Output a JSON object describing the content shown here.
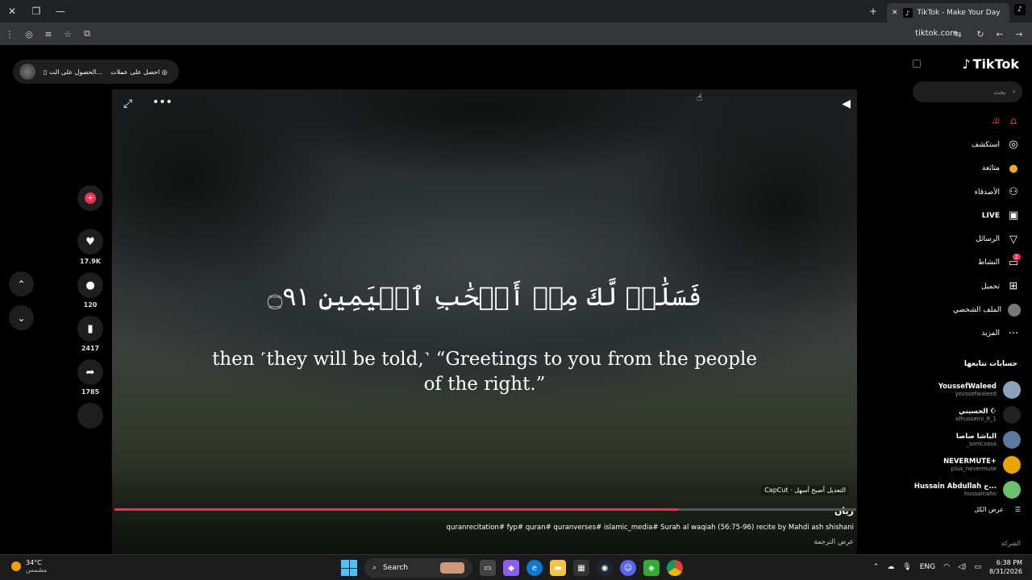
{
  "browser": {
    "tab_title": "TikTok - Make Your Day",
    "url": "tiktok.com",
    "new_tab_symbol": "+"
  },
  "promo": {
    "item1": "الحصول على الت...",
    "item2": "احصل على عملات"
  },
  "video": {
    "arabic_text": "فَسَلَٰمٞ لَّكَ مِنۡ أَصۡحَٰبِ ٱلۡيَمِينِ ۝٩١",
    "caption_line1": "then ˹they will be told,˺ “Greetings to you from the people",
    "caption_line2": "of the right.”",
    "capcut_label": "CapCut · التعديل أصبح أسهل",
    "author": "ريان",
    "description": "quranrecitation# fyp# quran# quranverses# islamic_media# Surah al waqiah (56:75-96) recite by Mahdi ash shishani",
    "translate": "عرض الترجمة",
    "progress_percent": 76
  },
  "actions": {
    "likes": "17.9K",
    "comments": "120",
    "saves": "2417",
    "shares": "1785"
  },
  "sidebar": {
    "logo": "TikTok",
    "search_placeholder": "بحث",
    "menu": [
      {
        "label": "لك",
        "icon": "home-icon"
      },
      {
        "label": "استكشف",
        "icon": "compass-icon"
      },
      {
        "label": "متابَعة",
        "icon": "following-icon"
      },
      {
        "label": "الأصدقاء",
        "icon": "friends-icon"
      },
      {
        "label": "LIVE",
        "icon": "live-icon"
      },
      {
        "label": "الرسائل",
        "icon": "messages-icon"
      },
      {
        "label": "النشاط",
        "icon": "activity-icon",
        "badge": "2"
      },
      {
        "label": "تحميل",
        "icon": "upload-icon"
      },
      {
        "label": "الملف الشخصي",
        "icon": "profile-icon"
      },
      {
        "label": "المزيد",
        "icon": "more-icon"
      }
    ],
    "following_title": "حسابات تتابعها",
    "accounts": [
      {
        "name": "YoussefWaleed",
        "handle": "yovssefwaleed"
      },
      {
        "name": "الحسيني ☪",
        "handle": "alhusseini_8_1"
      },
      {
        "name": "الباشا صاصا",
        "handle": "_sonicsasa"
      },
      {
        "name": "NEVERMUTE+",
        "handle": "plus_nevermute"
      },
      {
        "name": "Hussain Abdullah ح...",
        "handle": "hussainahn"
      }
    ],
    "see_all": "عرض الكل",
    "company": "الشركة"
  },
  "taskbar": {
    "temp": "34°C",
    "weather": "مشمس",
    "search": "Search",
    "lang": "ENG",
    "time": "6:38 PM",
    "date": "8/31/2026"
  }
}
